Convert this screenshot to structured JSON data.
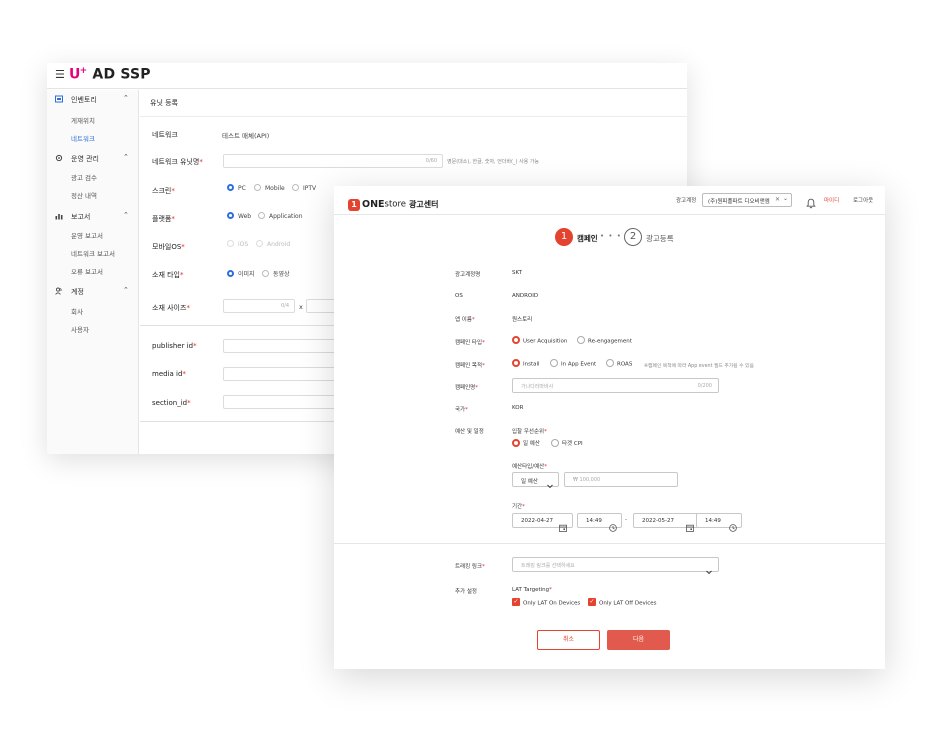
{
  "ssp": {
    "logo": {
      "u": "U",
      "plus": "+",
      "rest": "AD SSP"
    },
    "sidebar": {
      "inventory": {
        "label": "인벤토리",
        "items": [
          "게재위치",
          "네트워크"
        ]
      },
      "operations": {
        "label": "운영 관리",
        "items": [
          "광고 검수",
          "정산 내역"
        ]
      },
      "report": {
        "label": "보고서",
        "items": [
          "운영 보고서",
          "네트워크 보고서",
          "오류 보고서"
        ]
      },
      "account": {
        "label": "계정",
        "items": [
          "회사",
          "사용자"
        ]
      }
    },
    "page_title": "유닛 등록",
    "form": {
      "network": {
        "label": "네트워크",
        "value": "테스트 매체(API)"
      },
      "unit_name": {
        "label": "네트워크 유닛명",
        "counter": "0/60",
        "hint": "영문(대소), 한글, 숫자, 언더바(_) 사용 가능"
      },
      "screen": {
        "label": "스크린",
        "options": [
          "PC",
          "Mobile",
          "IPTV"
        ]
      },
      "platform": {
        "label": "플랫폼",
        "options": [
          "Web",
          "Application"
        ]
      },
      "mobile_os": {
        "label": "모바일OS",
        "options": [
          "iOS",
          "Android"
        ]
      },
      "creative_type": {
        "label": "소재 타입",
        "options": [
          "이미지",
          "동영상"
        ]
      },
      "creative_size": {
        "label": "소재 사이즈",
        "counter": "0/4",
        "separator": "x"
      },
      "publisher_id": {
        "label": "publisher id"
      },
      "media_id": {
        "label": "media id"
      },
      "section_id": {
        "label": "section_id"
      }
    }
  },
  "one": {
    "brand": {
      "num": "1",
      "one": "ONE",
      "store": "store",
      "center": "광고센터"
    },
    "header": {
      "account_label": "광고계정",
      "account_value": "(주)원피플파트 디오비앤엠",
      "mypage": "마이디",
      "logout": "로그아웃"
    },
    "steps": [
      {
        "num": "1",
        "label": "캠페인"
      },
      {
        "num": "2",
        "label": "광고등록"
      }
    ],
    "step_dots": "• • • •",
    "form": {
      "account_name": {
        "label": "광고계정명",
        "value": "SKT"
      },
      "os": {
        "label": "OS",
        "value": "ANDROID"
      },
      "app_name": {
        "label": "앱 이름",
        "value": "원스토리"
      },
      "campaign_type": {
        "label": "캠페인 타입",
        "options": [
          "User Acquisition",
          "Re-engagement"
        ]
      },
      "campaign_goal": {
        "label": "캠페인 목적",
        "options": [
          "Install",
          "In App Event",
          "ROAS"
        ],
        "hint": "※캠페인 목적에 따라 App event 필드 추가될 수 있음"
      },
      "campaign_name": {
        "label": "캠페인명",
        "placeholder": "가나다라마바사",
        "counter": "0/200"
      },
      "country": {
        "label": "국가",
        "value": "KOR"
      },
      "budget": {
        "label": "예산 및 일정",
        "priority_label": "입찰 우선순위",
        "priority_options": [
          "일 예산",
          "타겟 CPI"
        ],
        "budget_type_label": "예산타입/예산",
        "budget_type_value": "일 예산",
        "currency": "₩",
        "amount_placeholder": "100,000",
        "period_label": "기간",
        "start_date": "2022-04-27",
        "start_time": "14:49",
        "dash": "-",
        "end_date": "2022-05-27",
        "end_time": "14:49"
      },
      "tracking_link": {
        "label": "트래킹 링크",
        "placeholder": "트래킹 링크를 선택하세요"
      },
      "extra": {
        "label": "추가 설정",
        "lat_label": "LAT Targeting",
        "options": [
          "Only LAT On Devices",
          "Only LAT Off Devices"
        ]
      }
    },
    "buttons": {
      "cancel": "취소",
      "next": "다음"
    },
    "colors": {
      "accent": "#e4432f",
      "next_button": "#e15a4d",
      "link_blue": "#2a6fdb",
      "brand_pink": "#e5007e"
    }
  }
}
